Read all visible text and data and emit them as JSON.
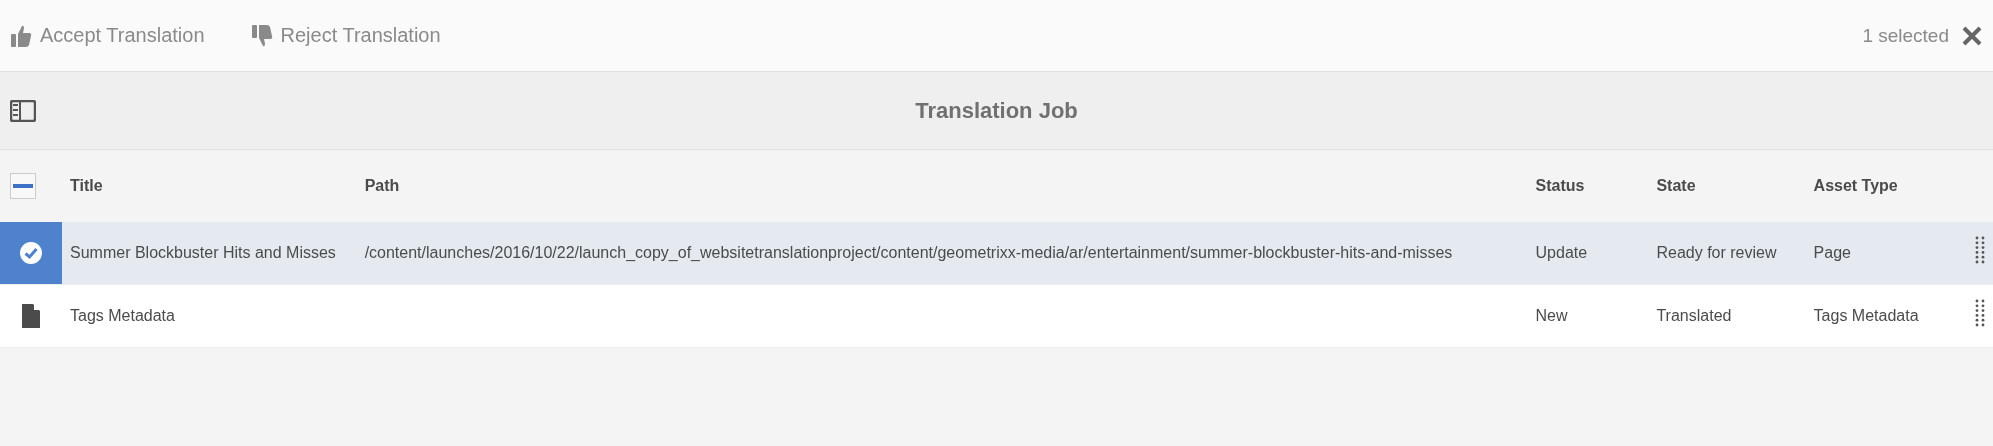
{
  "toolbar": {
    "actions": [
      {
        "kind": "accept",
        "label": "Accept Translation"
      },
      {
        "kind": "reject",
        "label": "Reject Translation"
      }
    ],
    "selection_count": "1 selected"
  },
  "title_bar": {
    "title": "Translation Job"
  },
  "table": {
    "select_all": {
      "indeterminate": true
    },
    "columns": [
      "Title",
      "Path",
      "Status",
      "State",
      "Asset Type"
    ],
    "rows": [
      {
        "selected": true,
        "title": "Summer Blockbuster Hits and Misses",
        "path": "/content/launches/2016/10/22/launch_copy_of_websitetranslationproject/content/geometrixx-media/ar/entertainment/summer-blockbuster-hits-and-misses",
        "status": "Update",
        "state": "Ready for review",
        "asset_type": "Page"
      },
      {
        "selected": false,
        "title": "Tags Metadata",
        "path": "",
        "status": "New",
        "state": "Translated",
        "asset_type": "Tags Metadata"
      }
    ]
  }
}
